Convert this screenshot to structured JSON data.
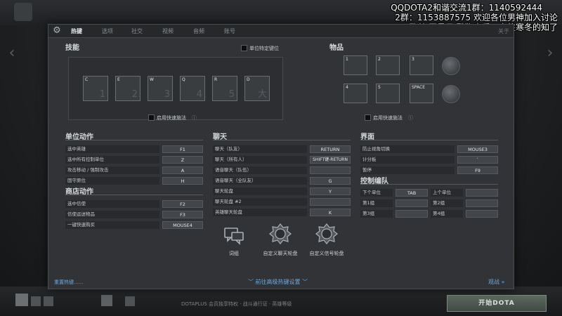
{
  "overlay": {
    "line1": "QQDOTA2和谐交流1群：1140592444",
    "line2": "2群：1153887575 欢迎各位男神加入讨论",
    "line3": "歌单 网易云 酷狗音乐：向往寒冬的知了"
  },
  "tabs": [
    {
      "label": "热键",
      "active": true
    },
    {
      "label": "选项"
    },
    {
      "label": "社交"
    },
    {
      "label": "视频"
    },
    {
      "label": "音频"
    },
    {
      "label": "账号"
    }
  ],
  "close_label": "关于",
  "skills": {
    "title": "技能",
    "unit_binding_label": "单位特定键位",
    "quickcast_label": "启用快速施法",
    "slots": [
      {
        "key": "C",
        "num": "1"
      },
      {
        "key": "E",
        "num": "2"
      },
      {
        "key": "W",
        "num": "3"
      },
      {
        "key": "Q",
        "num": "4"
      },
      {
        "key": "R",
        "num": "5"
      },
      {
        "key": "D",
        "num": "大"
      }
    ]
  },
  "items": {
    "title": "物品",
    "quickcast_label": "启用快速施法",
    "slots": [
      "1",
      "2",
      "3",
      "4",
      "5",
      "SPACE"
    ]
  },
  "unit_actions": {
    "title": "单位动作",
    "rows": [
      {
        "label": "选中英雄",
        "key": "F1"
      },
      {
        "label": "选中所有控制单位",
        "key": "Z"
      },
      {
        "label": "攻击移动 / 强制攻击",
        "key": "A"
      },
      {
        "label": "固守原位",
        "key": "H"
      }
    ]
  },
  "shop_actions": {
    "title": "商店动作",
    "rows": [
      {
        "label": "选中信使",
        "key": "F2"
      },
      {
        "label": "信使运送物品",
        "key": "F3"
      },
      {
        "label": "一键快速购买",
        "key": "MOUSE4"
      }
    ]
  },
  "chat": {
    "title": "聊天",
    "rows": [
      {
        "label": "聊天（队友）",
        "key": "RETURN"
      },
      {
        "label": "聊天（所有人）",
        "key": "SHIFT键-RETURN"
      },
      {
        "label": "语音聊天（队伍）",
        "key": ""
      },
      {
        "label": "语音聊天（全队友）",
        "key": "G"
      },
      {
        "label": "聊天轮盘",
        "key": "Y"
      },
      {
        "label": "聊天轮盘 #2",
        "key": ""
      },
      {
        "label": "英雄聊天轮盘",
        "key": "K"
      }
    ]
  },
  "interface": {
    "title": "界面",
    "rows": [
      {
        "label": "防止视角切换",
        "key": "MOUSE3"
      },
      {
        "label": "计分板",
        "key": "`"
      },
      {
        "label": "暂停",
        "key": "F9"
      }
    ]
  },
  "control_groups": {
    "title": "控制编队",
    "rows": [
      {
        "left_label": "下个单位",
        "left_key": "TAB",
        "right_label": "上个单位",
        "right_key": ""
      },
      {
        "left_label": "第1组",
        "left_key": "",
        "right_label": "第2组",
        "right_key": ""
      },
      {
        "left_label": "第3组",
        "left_key": "",
        "right_label": "第4组",
        "right_key": ""
      }
    ]
  },
  "bottom_buttons": [
    {
      "label": "词组"
    },
    {
      "label": "自定义聊天轮盘"
    },
    {
      "label": "自定义信号轮盘"
    }
  ],
  "footer": {
    "reset_label": "重置热键......",
    "advanced_label": "前往高级热键设置",
    "next_label": "观战"
  },
  "launcher": {
    "play_label": "开始DOTA",
    "news_text": "DOTAPLUS 会员独享特权 · 战斗通行证 · 英雄等级"
  },
  "colors": {
    "accent_link": "#6fa8dc",
    "panel_bg": "#313336"
  }
}
